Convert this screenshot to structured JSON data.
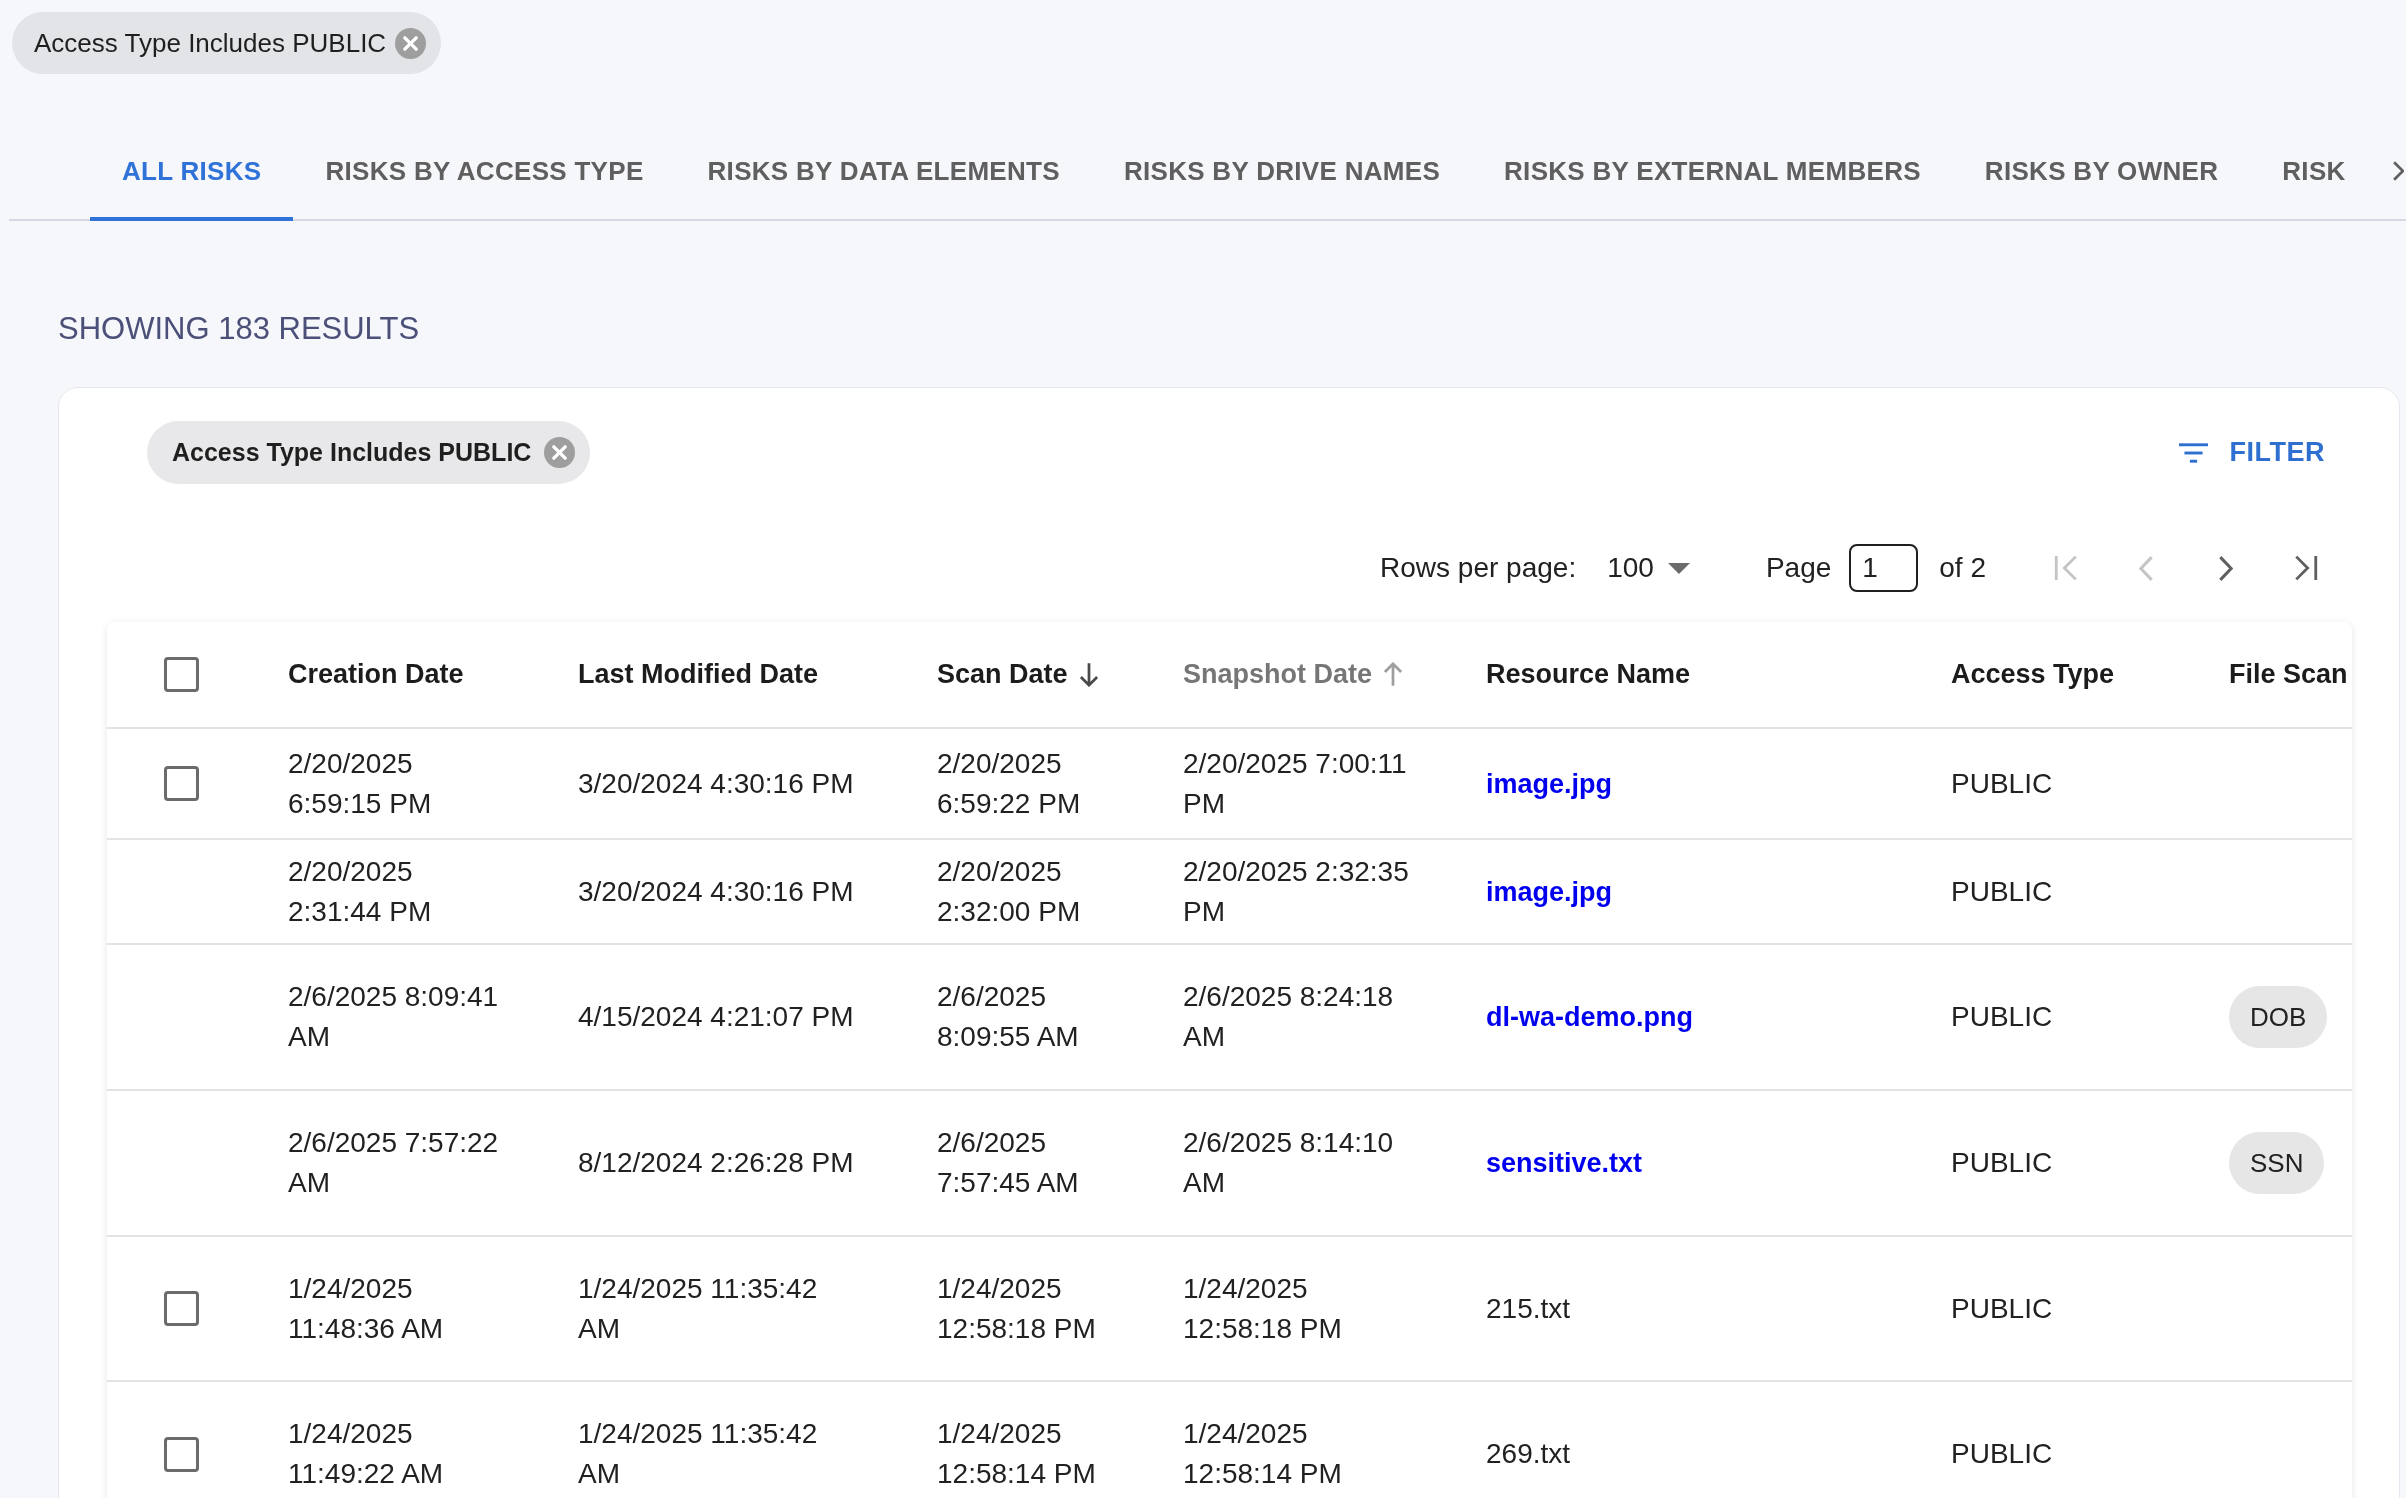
{
  "filter_chip": {
    "label": "Access Type Includes PUBLIC"
  },
  "tabs": [
    {
      "label": "ALL RISKS",
      "selected": true
    },
    {
      "label": "RISKS BY ACCESS TYPE",
      "selected": false
    },
    {
      "label": "RISKS BY DATA ELEMENTS",
      "selected": false
    },
    {
      "label": "RISKS BY DRIVE NAMES",
      "selected": false
    },
    {
      "label": "RISKS BY EXTERNAL MEMBERS",
      "selected": false
    },
    {
      "label": "RISKS BY OWNER",
      "selected": false
    },
    {
      "label": "RISK",
      "selected": false
    }
  ],
  "results_heading": "SHOWING 183 RESULTS",
  "card": {
    "filter_chip": {
      "label": "Access Type Includes PUBLIC"
    },
    "filter_button": {
      "label": "FILTER"
    }
  },
  "pagination": {
    "rows_per_page_label": "Rows per page:",
    "rows_per_page": "100",
    "page_label": "Page",
    "page": "1",
    "page_total": "of 2",
    "buttons": [
      {
        "kind": "first",
        "disabled": true
      },
      {
        "kind": "previous",
        "disabled": true
      },
      {
        "kind": "next",
        "disabled": false
      },
      {
        "kind": "last",
        "disabled": false
      }
    ]
  },
  "table": {
    "select_all": {
      "checked": false
    },
    "columns": [
      {
        "label": "Creation Date"
      },
      {
        "label": "Last Modified Date"
      },
      {
        "label": "Scan Date",
        "sort_ascending": false,
        "sort_active": true
      },
      {
        "label": "Snapshot Date",
        "sort_ascending": true,
        "sort_active": false
      },
      {
        "label": "Resource Name"
      },
      {
        "label": "Access Type"
      },
      {
        "label": "File Scan"
      }
    ],
    "rows": [
      {
        "checked": false,
        "creation_date": "2/20/2025 6:59:15 PM",
        "last_modified_date": "3/20/2024 4:30:16 PM",
        "scan_date": "2/20/2025 6:59:22 PM",
        "snapshot_date": "2/20/2025 7:00:11 PM",
        "resource_name": "image.jpg",
        "resource_link": true,
        "access_type": "PUBLIC"
      },
      {
        "creation_date": "2/20/2025 2:31:44 PM",
        "last_modified_date": "3/20/2024 4:30:16 PM",
        "scan_date": "2/20/2025 2:32:00 PM",
        "snapshot_date": "2/20/2025 2:32:35 PM",
        "resource_name": "image.jpg",
        "resource_link": true,
        "access_type": "PUBLIC"
      },
      {
        "creation_date": "2/6/2025 8:09:41 AM",
        "last_modified_date": "4/15/2024 4:21:07 PM",
        "scan_date": "2/6/2025 8:09:55 AM",
        "snapshot_date": "2/6/2025 8:24:18 AM",
        "resource_name": "dl-wa-demo.png",
        "resource_link": true,
        "access_type": "PUBLIC",
        "file_scan": [
          "DOB"
        ]
      },
      {
        "creation_date": "2/6/2025 7:57:22 AM",
        "last_modified_date": "8/12/2024 2:26:28 PM",
        "scan_date": "2/6/2025 7:57:45 AM",
        "snapshot_date": "2/6/2025 8:14:10 AM",
        "resource_name": "sensitive.txt",
        "resource_link": true,
        "access_type": "PUBLIC",
        "file_scan": [
          "SSN"
        ]
      },
      {
        "checked": false,
        "creation_date": "1/24/2025 11:48:36 AM",
        "last_modified_date": "1/24/2025 11:35:42 AM",
        "scan_date": "1/24/2025 12:58:18 PM",
        "snapshot_date": "1/24/2025 12:58:18 PM",
        "resource_name": "215.txt",
        "resource_link": false,
        "access_type": "PUBLIC"
      },
      {
        "checked": false,
        "creation_date": "1/24/2025 11:49:22 AM",
        "last_modified_date": "1/24/2025 11:35:42 AM",
        "scan_date": "1/24/2025 12:58:14 PM",
        "snapshot_date": "1/24/2025 12:58:14 PM",
        "resource_name": "269.txt",
        "resource_link": false,
        "access_type": "PUBLIC"
      }
    ]
  }
}
